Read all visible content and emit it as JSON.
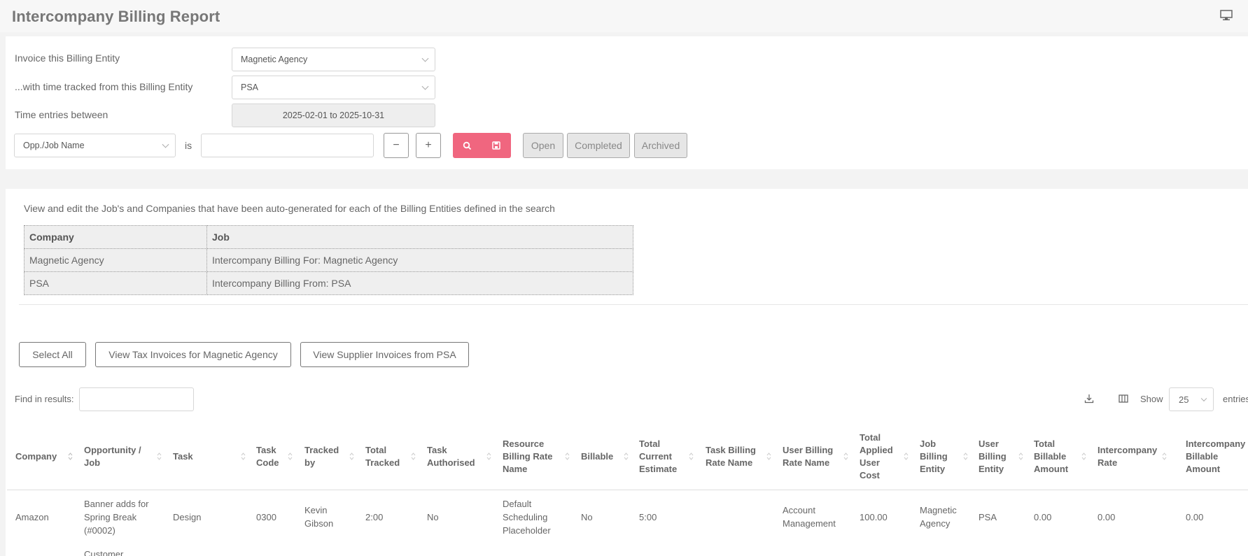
{
  "page": {
    "title": "Intercompany Billing Report"
  },
  "filters": {
    "invoice_entity_label": "Invoice this Billing Entity",
    "invoice_entity_value": "Magnetic Agency",
    "tracked_entity_label": "...with time tracked from this Billing Entity",
    "tracked_entity_value": "PSA",
    "time_entries_label": "Time entries between",
    "date_range_value": "2025-02-01 to 2025-10-31",
    "field_select_value": "Opp./Job Name",
    "operator_label": "is",
    "minus_label": "−",
    "plus_label": "+",
    "status_buttons": [
      "Open",
      "Completed",
      "Archived"
    ]
  },
  "info": {
    "text": "View and edit the Job's and Companies that have been auto-generated for each of the Billing Entities defined in the search",
    "headers": [
      "Company",
      "Job"
    ],
    "rows": [
      [
        "Magnetic Agency",
        "Intercompany Billing For: Magnetic Agency"
      ],
      [
        "PSA",
        "Intercompany Billing From: PSA"
      ]
    ]
  },
  "actions": {
    "select_all": "Select All",
    "view_tax": "View Tax Invoices for Magnetic Agency",
    "view_supplier": "View Supplier Invoices from PSA"
  },
  "results": {
    "find_label": "Find in results:",
    "show_label": "Show",
    "show_value": "25",
    "entries_label": "entries",
    "columns": [
      "Company",
      "Opportunity / Job",
      "Task",
      "Task Code",
      "Tracked by",
      "Total Tracked",
      "Task Authorised",
      "Resource Billing Rate Name",
      "Billable",
      "Total Current Estimate",
      "Task Billing Rate Name",
      "User Billing Rate Name",
      "Total Applied User Cost",
      "Job Billing Entity",
      "User Billing Entity",
      "Total Billable Amount",
      "Intercompany Rate",
      "Intercompany Billable Amount"
    ],
    "rows": [
      [
        "Amazon",
        "Banner adds for Spring Break (#0002)",
        "Design",
        "0300",
        "Kevin Gibson",
        "2:00",
        "No",
        "Default Scheduling Placeholder",
        "No",
        "5:00",
        "",
        "Account Management",
        "100.00",
        "Magnetic Agency",
        "PSA",
        "0.00",
        "0.00",
        "0.00"
      ]
    ],
    "next_row_partial": "Customer"
  },
  "colors": {
    "accent": "#f0667f",
    "panel": "#ffffff",
    "background": "#f3f3f3"
  },
  "icons": [
    "monitor-icon",
    "search-icon",
    "save-icon",
    "download-icon",
    "columns-icon",
    "sort-icon",
    "chevron-down-icon"
  ]
}
